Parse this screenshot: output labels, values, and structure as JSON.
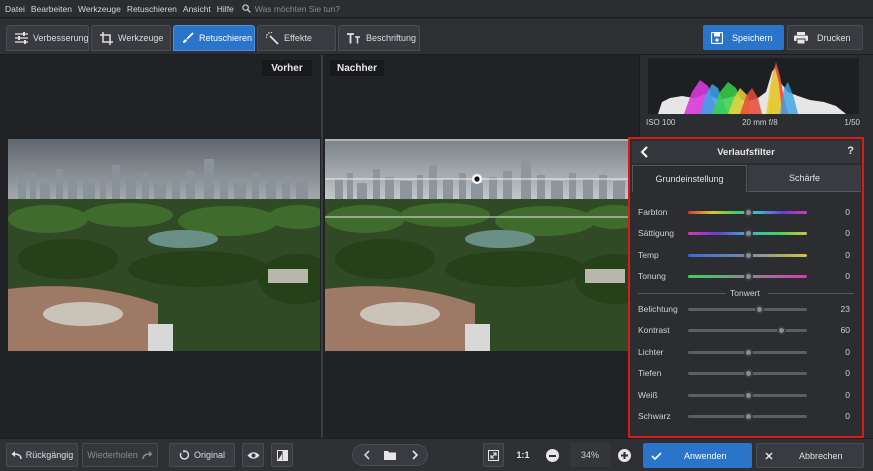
{
  "menu": {
    "items": [
      "Datei",
      "Bearbeiten",
      "Werkzeuge",
      "Retuschieren",
      "Ansicht",
      "Hilfe"
    ],
    "search_placeholder": "Was möchten Sie tun?"
  },
  "toolbar": {
    "tabs": [
      {
        "label": "Verbesserung",
        "icon": "sliders-icon"
      },
      {
        "label": "Werkzeuge",
        "icon": "crop-icon"
      },
      {
        "label": "Retuschieren",
        "icon": "brush-icon",
        "active": true
      },
      {
        "label": "Effekte",
        "icon": "magic-wand-icon"
      },
      {
        "label": "Beschriftung",
        "icon": "text-icon"
      }
    ],
    "save_label": "Speichern",
    "print_label": "Drucken"
  },
  "canvas": {
    "before_label": "Vorher",
    "after_label": "Nachher"
  },
  "info": {
    "iso": "ISO 100",
    "lens": "20 mm f/8",
    "shutter": "1/50"
  },
  "filter_panel": {
    "title": "Verlaufsfilter",
    "help": "?",
    "tabs": [
      "Grundeinstellung",
      "Schärfe"
    ],
    "color_sliders": [
      {
        "label": "Farbton",
        "value": "0",
        "position": 0.5
      },
      {
        "label": "Sättigung",
        "value": "0",
        "position": 0.5
      },
      {
        "label": "Temp",
        "value": "0",
        "position": 0.5
      },
      {
        "label": "Tonung",
        "value": "0",
        "position": 0.5
      }
    ],
    "section_title": "Tonwert",
    "tone_sliders": [
      {
        "label": "Belichtung",
        "value": "23",
        "position": 0.6
      },
      {
        "label": "Kontrast",
        "value": "60",
        "position": 0.78
      },
      {
        "label": "Lichter",
        "value": "0",
        "position": 0.5
      },
      {
        "label": "Tiefen",
        "value": "0",
        "position": 0.5
      },
      {
        "label": "Weiß",
        "value": "0",
        "position": 0.5
      },
      {
        "label": "Schwarz",
        "value": "0",
        "position": 0.5
      }
    ]
  },
  "bottom": {
    "undo_label": "Rückgängig",
    "redo_label": "Wiederholen",
    "original_label": "Original",
    "one_to_one": "1:1",
    "zoom": "34%",
    "apply_label": "Anwenden",
    "cancel_label": "Abbrechen"
  },
  "colors": {
    "accent": "#2a74c9",
    "highlight_border": "#d81a1a"
  }
}
